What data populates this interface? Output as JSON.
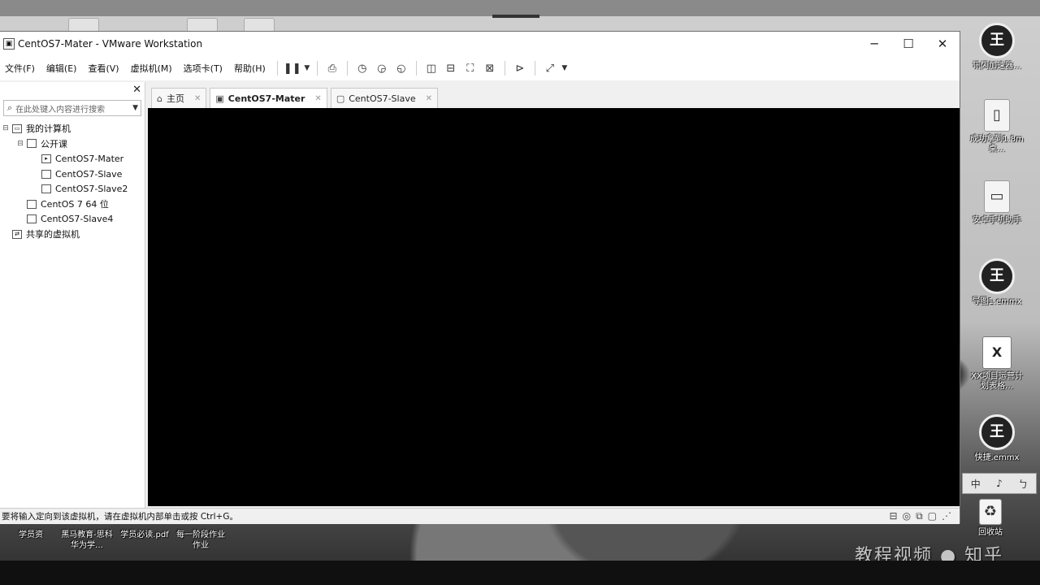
{
  "window": {
    "title": "CentOS7-Mater - VMware Workstation",
    "minimize": "─",
    "maximize": "☐",
    "close": "✕"
  },
  "menu": [
    {
      "label": "文件(F)"
    },
    {
      "label": "编辑(E)"
    },
    {
      "label": "查看(V)"
    },
    {
      "label": "虚拟机(M)"
    },
    {
      "label": "选项卡(T)"
    },
    {
      "label": "帮助(H)"
    }
  ],
  "toolbar_icons": [
    "pause-icon",
    "dropdown-icon",
    "send-keys-icon",
    "snapshot-icon",
    "revert-snapshot-icon",
    "snapshot-manager-icon",
    "library-view-icon",
    "thumbnail-view-icon",
    "fullscreen-icon",
    "unity-icon",
    "console-icon",
    "stretch-icon",
    "dropdown-icon"
  ],
  "library": {
    "search_placeholder": "在此处键入内容进行搜索",
    "tree": {
      "my_computer": "我的计算机",
      "folder": "公开课",
      "vm1": "CentOS7-Mater",
      "vm2": "CentOS7-Slave",
      "vm3": "CentOS7-Slave2",
      "vm4": "CentOS 7 64 位",
      "vm5": "CentOS7-Slave4",
      "shared": "共享的虚拟机"
    }
  },
  "tabs": [
    {
      "label": "主页"
    },
    {
      "label": "CentOS7-Mater"
    },
    {
      "label": "CentOS7-Slave"
    }
  ],
  "status": {
    "message": "要将输入定向到该虚拟机，请在虚拟机内部单击或按 Ctrl+G。"
  },
  "desktop": {
    "icons": [
      {
        "label": "讯闪加速器…"
      },
      {
        "label": "成功拿到1.8m桌…"
      },
      {
        "label": "安卓手机助手"
      },
      {
        "label": "导图1.emmx"
      },
      {
        "label": "XX项目运营计划表格…"
      },
      {
        "label": "快捷.emmx"
      },
      {
        "label": "回收站"
      }
    ],
    "bottom_labels": [
      {
        "label": "学员资"
      },
      {
        "label": "黑马教育-思科华为学…"
      },
      {
        "label": "学员必读.pdf"
      },
      {
        "label": "每一阶段作业作业"
      }
    ],
    "language_bar": [
      "中",
      "♪",
      "ㄅ"
    ],
    "watermark": "教程视频 ● 知乎"
  }
}
